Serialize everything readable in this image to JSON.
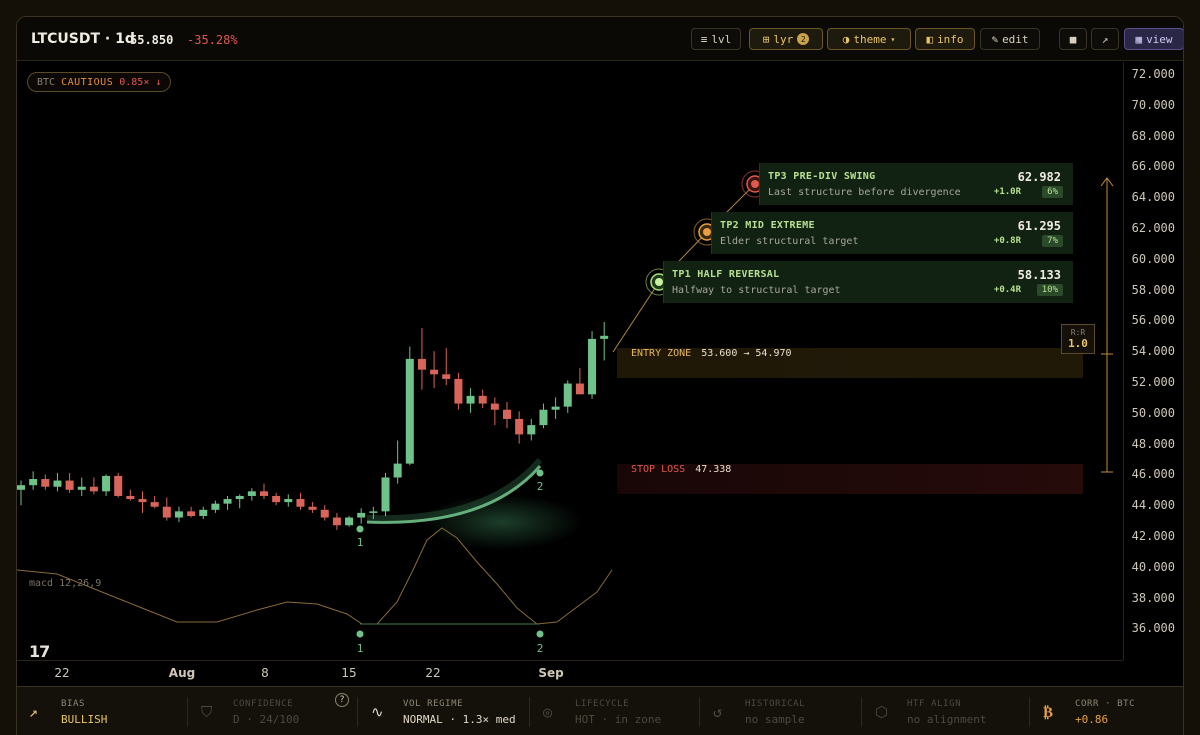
{
  "header": {
    "symbol": "LTCUSDT · 1d",
    "price": "55.850",
    "change": "-35.28%",
    "buttons": {
      "lvl": "lvl",
      "lyr": "lyr",
      "lyr_badge": "2",
      "theme": "theme",
      "info": "info",
      "edit": "edit",
      "view": "view"
    }
  },
  "btc_pill": {
    "label": "BTC",
    "mode": "CAUTIOUS",
    "ratio": "0.85× ↓"
  },
  "y_axis": [
    "72.000",
    "70.000",
    "68.000",
    "66.000",
    "64.000",
    "62.000",
    "60.000",
    "58.000",
    "56.000",
    "54.000",
    "52.000",
    "50.000",
    "48.000",
    "46.000",
    "44.000",
    "42.000",
    "40.000",
    "38.000",
    "36.000"
  ],
  "x_axis": [
    {
      "label": "22",
      "bold": false
    },
    {
      "label": "Aug",
      "bold": true
    },
    {
      "label": "8",
      "bold": false
    },
    {
      "label": "15",
      "bold": false
    },
    {
      "label": "22",
      "bold": false
    },
    {
      "label": "Sep",
      "bold": true
    }
  ],
  "targets": [
    {
      "title": "TP3 PRE-DIV SWING",
      "subtitle": "Last structure before divergence",
      "price": "62.982",
      "r": "+1.0R",
      "pct": "6%",
      "color": "#e0584f"
    },
    {
      "title": "TP2 MID EXTREME",
      "subtitle": "Elder structural target",
      "price": "61.295",
      "r": "+0.8R",
      "pct": "7%",
      "color": "#e8a040"
    },
    {
      "title": "TP1 HALF REVERSAL",
      "subtitle": "Halfway to structural target",
      "price": "58.133",
      "r": "+0.4R",
      "pct": "10%",
      "color": "#a8e080"
    }
  ],
  "entry_zone": {
    "label": "ENTRY ZONE",
    "value": "53.600 → 54.970"
  },
  "stop_loss": {
    "label": "STOP LOSS",
    "value": "47.338"
  },
  "rr": {
    "label": "R:R",
    "value": "1.0"
  },
  "pivots": {
    "p1": "1",
    "p2": "2",
    "m1": "1",
    "m2": "2"
  },
  "macd_label": "macd 12,26,9",
  "tv_logo": "17",
  "footer": [
    {
      "key": "BIAS",
      "value": "BULLISH",
      "icon": "trend-up-icon",
      "state": "lit"
    },
    {
      "key": "CONFIDENCE",
      "value": "D · 24/100",
      "icon": "shield-icon",
      "state": "dim"
    },
    {
      "key": "VOL REGIME",
      "value": "NORMAL · 1.3× med",
      "icon": "wave-icon",
      "state": "lit"
    },
    {
      "key": "LIFECYCLE",
      "value": "HOT · in zone",
      "icon": "target-icon",
      "state": "dim"
    },
    {
      "key": "HISTORICAL",
      "value": "no sample",
      "icon": "history-icon",
      "state": "dim"
    },
    {
      "key": "HTF ALIGN",
      "value": "no alignment",
      "icon": "hexagon-icon",
      "state": "dim"
    },
    {
      "key": "CORR · BTC",
      "value": "+0.86",
      "icon": "bitcoin-icon",
      "state": "lit"
    }
  ],
  "footer_help": "?",
  "colors": {
    "up": "#6fc28a",
    "down": "#d9655a",
    "bias": "#e8c56a",
    "corr": "#e8a040"
  }
}
